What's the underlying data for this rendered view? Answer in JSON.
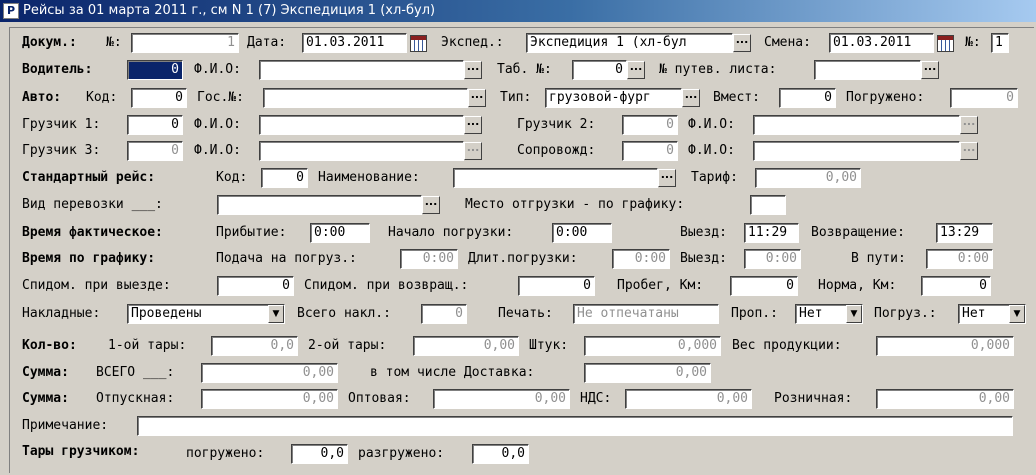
{
  "window": {
    "title": "Рейсы за 01 марта 2011 г., см N 1 (7) Экспедиция 1 (хл-бул)",
    "icon_letter": "P"
  },
  "doc": {
    "label": "Докум.:",
    "no_label": "№:",
    "no_value": "1",
    "date_label": "Дата:",
    "date_value": "01.03.2011",
    "exped_label": "Экспед.:",
    "exped_value": "Экспедиция 1 (хл-бул",
    "shift_label": "Смена:",
    "shift_value": "01.03.2011",
    "shift_no_label": "№:",
    "shift_no_value": "1"
  },
  "driver": {
    "label": "Водитель:",
    "id_value": "0",
    "fio_label": "Ф.И.О:",
    "fio_value": "",
    "tab_label": "Таб. №:",
    "tab_value": "0",
    "waybill_label": "№ путев. листа:",
    "waybill_value": ""
  },
  "auto": {
    "label": "Авто:",
    "code_label": "Код:",
    "code_value": "0",
    "gos_label": "Гос.№:",
    "gos_value": "",
    "type_label": "Тип:",
    "type_value": "грузовой-фург",
    "capacity_label": "Вмест:",
    "capacity_value": "0",
    "loaded_label": "Погружено:",
    "loaded_value": "0"
  },
  "loaders": {
    "l1_label": "Грузчик 1:",
    "l1_value": "0",
    "l1_fio_label": "Ф.И.О:",
    "l2_label": "Грузчик 2:",
    "l2_value": "0",
    "l2_fio_label": "Ф.И.О:",
    "l3_label": "Грузчик 3:",
    "l3_value": "0",
    "l3_fio_label": "Ф.И.О:",
    "escort_label": "Сопровожд:",
    "escort_value": "0",
    "escort_fio_label": "Ф.И.О:"
  },
  "route": {
    "label": "Стандартный рейс:",
    "code_label": "Код:",
    "code_value": "0",
    "name_label": "Наименование:",
    "name_value": "",
    "tariff_label": "Тариф:",
    "tariff_value": "0,00"
  },
  "transport": {
    "label": "Вид  перевозки ___:",
    "value": "",
    "place_label": "Место отгрузки - по графику:",
    "place_value": ""
  },
  "actual_time": {
    "label": "Время фактическое:",
    "arrival_label": "Прибытие:",
    "arrival_value": "0:00",
    "load_start_label": "Начало погрузки:",
    "load_start_value": "0:00",
    "departure_label": "Выезд:",
    "departure_value": "11:29",
    "return_label": "Возвращение:",
    "return_value": "13:29"
  },
  "schedule_time": {
    "label": "Время  по графику:",
    "supply_label": "Подача на погруз.:",
    "supply_value": "0:00",
    "duration_label": "Длит.погрузки:",
    "duration_value": "0:00",
    "departure_label": "Выезд:",
    "departure_value": "0:00",
    "transit_label": "В пути:",
    "transit_value": "0:00"
  },
  "odometer": {
    "out_label": "Спидом. при выезде:",
    "out_value": "0",
    "back_label": "Спидом. при возвращ.:",
    "back_value": "0",
    "mileage_label": "Пробег, Км:",
    "mileage_value": "0",
    "norm_label": "Норма, Км:",
    "norm_value": "0"
  },
  "invoices": {
    "label": "Накладные:",
    "status_value": "Проведены",
    "total_label": "Всего накл.:",
    "total_value": "0",
    "print_label": "Печать:",
    "print_value": "Не отпечатаны",
    "prop_label": "Проп.:",
    "prop_value": "Нет",
    "load_label": "Погруз.:",
    "load_value": "Нет"
  },
  "quantity": {
    "label": "Кол-во:",
    "tara1_label": "1-ой тары:",
    "tara1_value": "0,0",
    "tara2_label": "2-ой тары:",
    "tara2_value": "0,00",
    "pieces_label": "Штук:",
    "pieces_value": "0,000",
    "weight_label": "Вес продукции:",
    "weight_value": "0,000"
  },
  "sum1": {
    "label": "Сумма:",
    "total_label": "ВСЕГО ___:",
    "total_value": "0,00",
    "delivery_label": "в том числе Доставка:",
    "delivery_value": "0,00"
  },
  "sum2": {
    "label": "Сумма:",
    "release_label": "Отпускная:",
    "release_value": "0,00",
    "wholesale_label": "Оптовая:",
    "wholesale_value": "0,00",
    "vat_label": "НДС:",
    "vat_value": "0,00",
    "retail_label": "Розничная:",
    "retail_value": "0,00"
  },
  "note": {
    "label": "Примечание:",
    "value": ""
  },
  "loader_tara": {
    "label": "Тары грузчиком:",
    "loaded_label": "погружено:",
    "loaded_value": "0,0",
    "unloaded_label": "разгружено:",
    "unloaded_value": "0,0"
  },
  "icons": {
    "lookup": "...",
    "dropdown": "▼"
  }
}
